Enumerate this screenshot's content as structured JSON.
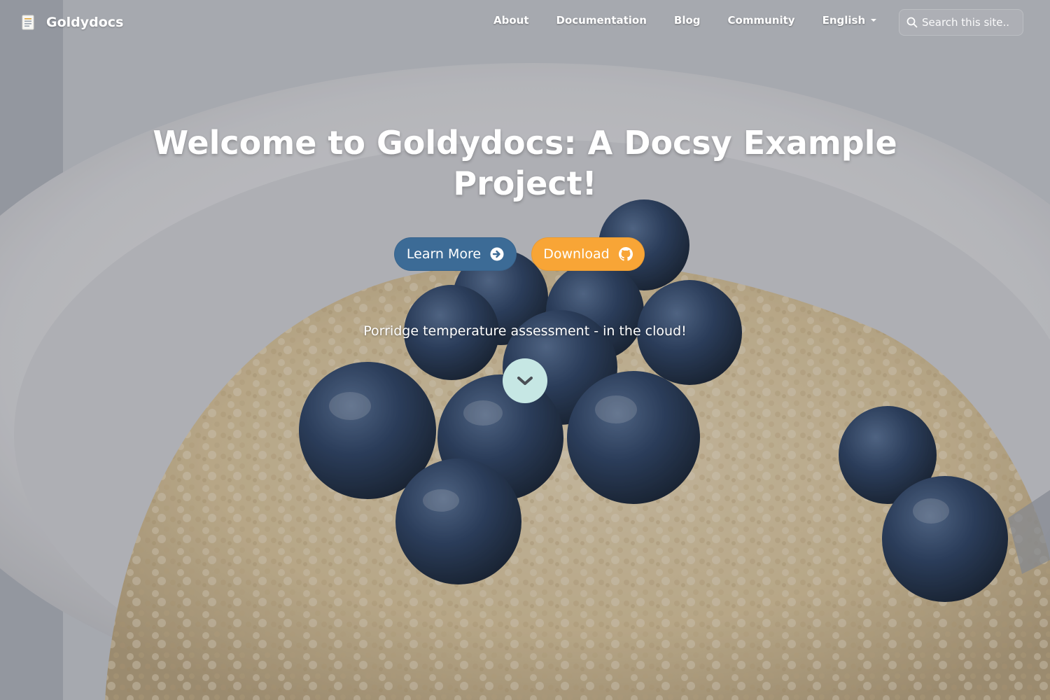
{
  "site": {
    "brand_name": "Goldydocs",
    "brand_icon": "document-icon"
  },
  "nav": {
    "items": [
      {
        "label": "About"
      },
      {
        "label": "Documentation"
      },
      {
        "label": "Blog"
      },
      {
        "label": "Community"
      }
    ],
    "language": {
      "label": "English",
      "icon": "chevron-down-icon"
    }
  },
  "search": {
    "placeholder": "Search this site..",
    "value": "",
    "icon": "search-icon"
  },
  "hero": {
    "title": "Welcome to Goldydocs: A Docsy Example Project!",
    "tagline": "Porridge temperature assessment - in the cloud!",
    "learn_more": {
      "label": "Learn More",
      "icon": "arrow-circle-right-icon",
      "color": "#3c6b96"
    },
    "download": {
      "label": "Download",
      "icon": "github-icon",
      "color": "#f8a536"
    },
    "scroll_icon": "chevron-down-icon",
    "scroll_color": "#c6e7e4",
    "background": "porridge-with-blueberries-photo"
  }
}
